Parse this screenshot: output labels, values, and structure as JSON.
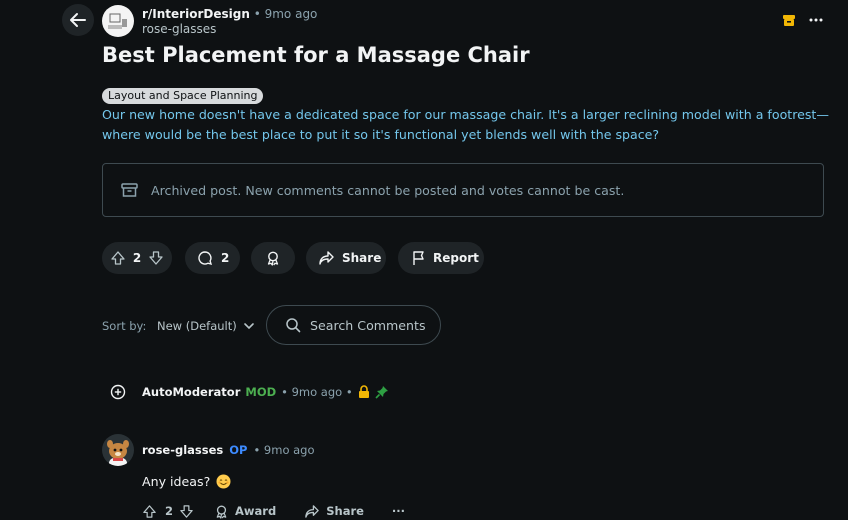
{
  "post": {
    "subreddit": "r/InteriorDesign",
    "separator": "•",
    "time": "9mo ago",
    "author": "rose-glasses",
    "title": "Best Placement for a Massage Chair",
    "flair": "Layout and Space Planning",
    "body_line1": "Our new home doesn't have a dedicated space for our massage chair. It's a larger reclining model with a footrest—",
    "body_line2": "where would be the best place to put it so it's functional yet blends well with the space?",
    "archived_notice": "Archived post. New comments cannot be posted and votes cannot be cast.",
    "votes": "2",
    "comments": "2",
    "share_label": "Share",
    "report_label": "Report"
  },
  "sort": {
    "label": "Sort by:",
    "value": "New (Default)"
  },
  "search": {
    "placeholder": "Search Comments"
  },
  "comments": [
    {
      "author": "AutoModerator",
      "badge": "MOD",
      "time": "• 9mo ago •"
    },
    {
      "author": "rose-glasses",
      "badge": "OP",
      "time": "• 9mo ago",
      "text": "Any ideas?",
      "votes": "2",
      "award_label": "Award",
      "share_label": "Share",
      "more": "···"
    }
  ],
  "colors": {
    "background": "#0e1113",
    "link": "#74c7ec",
    "mod_green": "#4caf50",
    "op_blue": "#3d8bff",
    "lock_yellow": "#f2b705"
  }
}
